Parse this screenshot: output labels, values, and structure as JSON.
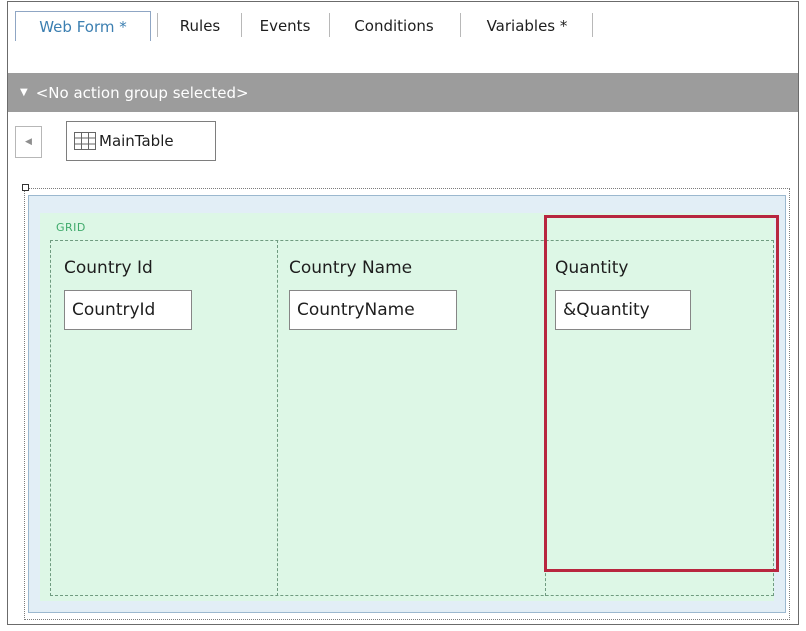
{
  "tabs": [
    {
      "label": "Web Form *",
      "active": true
    },
    {
      "label": "Rules",
      "active": false
    },
    {
      "label": "Events",
      "active": false
    },
    {
      "label": "Conditions",
      "active": false
    },
    {
      "label": "Variables *",
      "active": false
    }
  ],
  "action_group": {
    "text": "<No action group selected>"
  },
  "breadcrumb": {
    "label": "MainTable"
  },
  "grid": {
    "label": "GRID",
    "columns": [
      {
        "title": "Country Id",
        "field": "CountryId"
      },
      {
        "title": "Country Name",
        "field": "CountryName"
      },
      {
        "title": "Quantity",
        "field": "&Quantity"
      }
    ]
  },
  "colors": {
    "active_tab_text": "#3c7fb1",
    "action_bar": "#9c9c9c",
    "grid_background": "#ddf7e6",
    "table_background": "#e2eef6",
    "highlight": "#b8263f"
  }
}
